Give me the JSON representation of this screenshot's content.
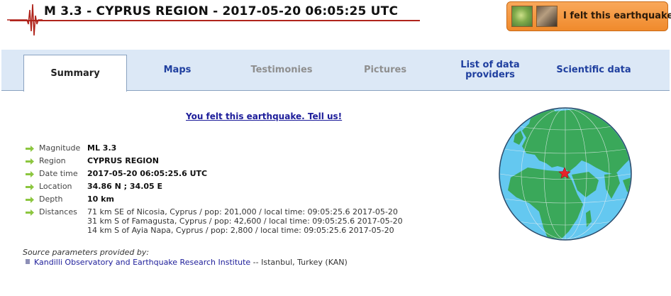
{
  "header": {
    "title": "M 3.3 - CYPRUS REGION - 2017-05-20 06:05:25 UTC",
    "felt_button_label": "I felt this earthquake"
  },
  "tabs": [
    {
      "label": "Summary",
      "state": "active"
    },
    {
      "label": "Maps",
      "state": "link"
    },
    {
      "label": "Testimonies",
      "state": "dim"
    },
    {
      "label": "Pictures",
      "state": "dim"
    },
    {
      "label": "List of data providers",
      "state": "link"
    },
    {
      "label": "Scientific data",
      "state": "link"
    }
  ],
  "felt_link": "You felt this earthquake. Tell us!",
  "parameters": [
    {
      "key": "Magnitude",
      "value": "ML 3.3"
    },
    {
      "key": "Region",
      "value": "CYPRUS REGION"
    },
    {
      "key": "Date time",
      "value": "2017-05-20 06:05:25.6 UTC"
    },
    {
      "key": "Location",
      "value": "34.86 N ; 34.05 E"
    },
    {
      "key": "Depth",
      "value": "10 km"
    }
  ],
  "distances_label": "Distances",
  "distances": [
    "71 km SE of Nicosia, Cyprus / pop: 201,000 / local time: 09:05:25.6 2017-05-20",
    "31 km S of Famagusta, Cyprus / pop: 42,600 / local time: 09:05:25.6 2017-05-20",
    "14 km S of Ayia Napa, Cyprus / pop: 2,800 / local time: 09:05:25.6 2017-05-20"
  ],
  "source": {
    "title": "Source parameters provided by:",
    "agency": "Kandilli Observatory and Earthquake Research Institute",
    "location": " -- Istanbul, Turkey (KAN)"
  },
  "colors": {
    "title_underline": "#b0241c",
    "tab_bar": "#dce8f6",
    "link": "#1f3f9f",
    "arrow": "#8cc63f",
    "ocean": "#64c8f0",
    "land": "#3aa85a",
    "epicenter": "#e8232a"
  },
  "icons": [
    "seismogram-icon",
    "arrow-bullet-icon",
    "epicenter-star-icon"
  ]
}
